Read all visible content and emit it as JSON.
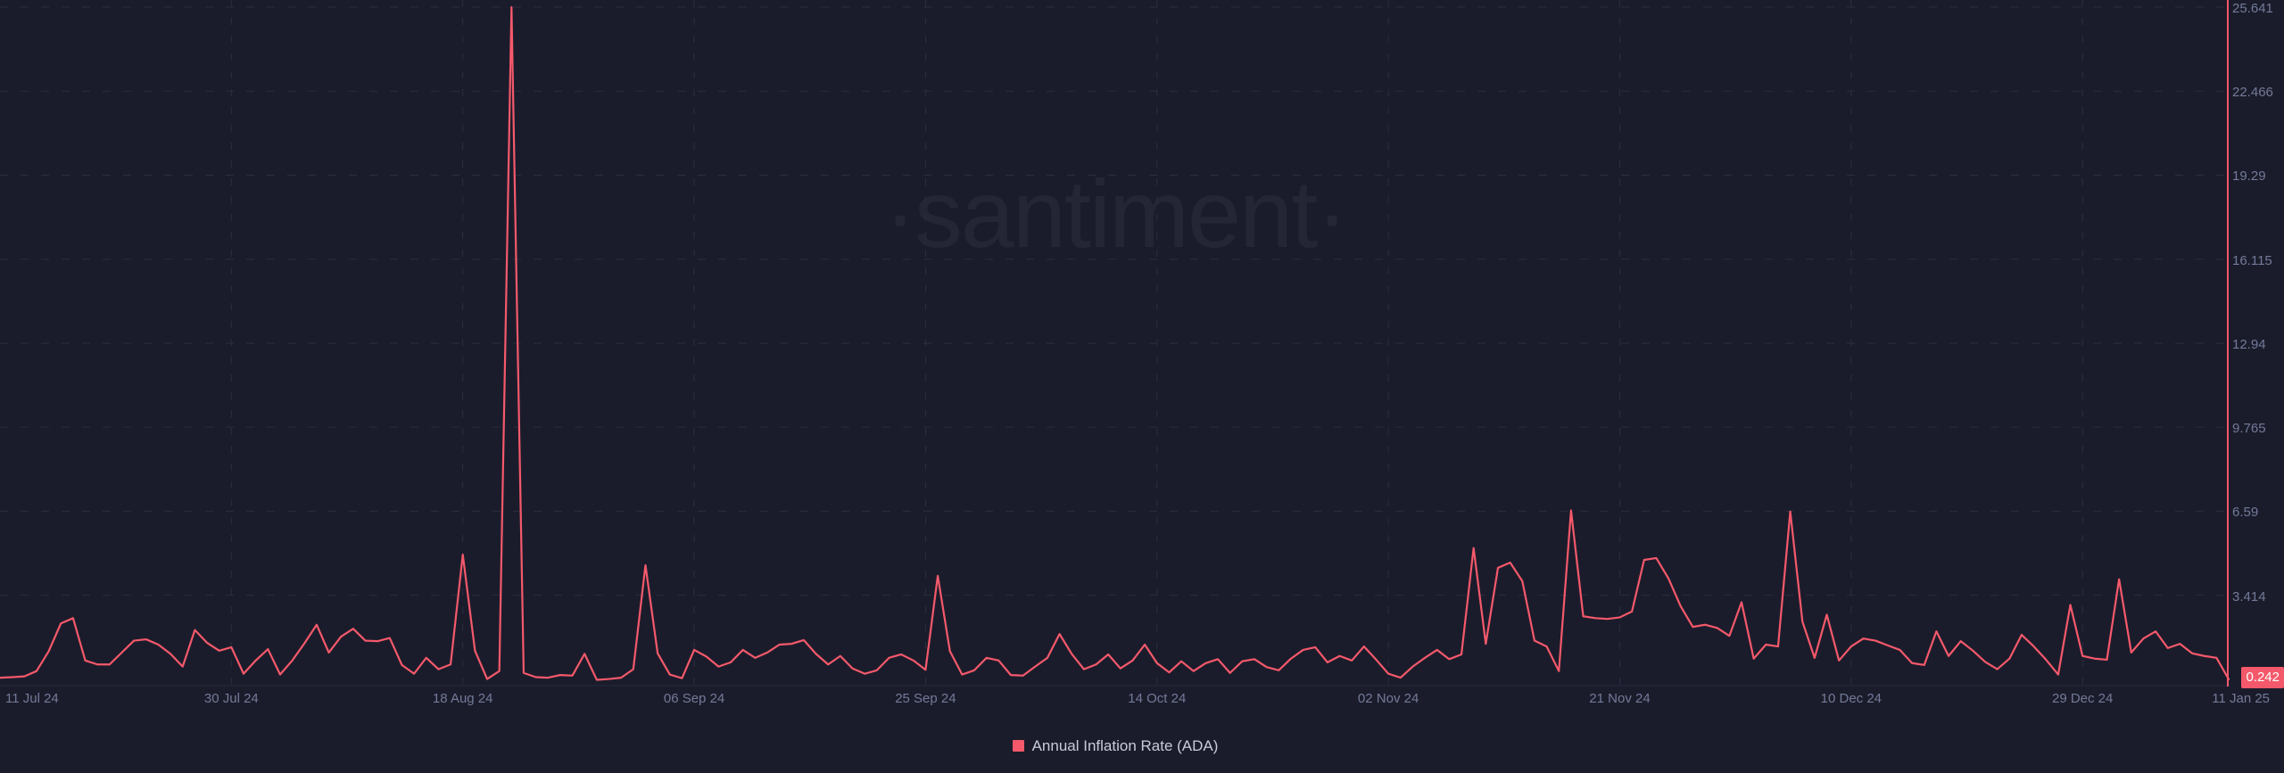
{
  "watermark": {
    "text": "·santiment·",
    "color": "#242636"
  },
  "theme": {
    "background": "#1b1c2b",
    "series_color": "#f4596b",
    "grid_color": "#2b2d40",
    "axis_text_color": "#737a99"
  },
  "legend": {
    "position": "bottom-center",
    "items": [
      {
        "label": "Annual Inflation Rate (ADA)",
        "color": "#f4596b",
        "marker": "square-swatch-icon"
      }
    ]
  },
  "last_value_badge": {
    "text": "0.242",
    "color": "#f4596b"
  },
  "cursor_line": {
    "x_fraction": 1.0,
    "color": "#f4596b"
  },
  "chart_data": {
    "type": "line",
    "title": "",
    "subtitle": "",
    "xlabel": "",
    "ylabel": "",
    "grid": true,
    "legend_position": "bottom-center",
    "ylim": [
      0,
      25.641
    ],
    "ytick_labels": [
      "25.641",
      "22.466",
      "19.29",
      "16.115",
      "12.94",
      "9.765",
      "6.59",
      "3.414"
    ],
    "yticks": [
      25.641,
      22.466,
      19.29,
      16.115,
      12.94,
      9.765,
      6.59,
      3.414
    ],
    "xtick_labels": [
      "11 Jul 24",
      "30 Jul 24",
      "18 Aug 24",
      "06 Sep 24",
      "25 Sep 24",
      "14 Oct 24",
      "02 Nov 24",
      "21 Nov 24",
      "10 Dec 24",
      "29 Dec 24",
      "11 Jan 25"
    ],
    "xtick_index": [
      0,
      19,
      38,
      57,
      76,
      95,
      114,
      133,
      152,
      171,
      184
    ],
    "x_start": "11 Jul 24",
    "x_end": "11 Jan 25",
    "series": [
      {
        "name": "Annual Inflation Rate (ADA)",
        "color": "#f4596b",
        "last_value": 0.242,
        "values": [
          0.3,
          0.32,
          0.35,
          0.55,
          1.3,
          2.35,
          2.55,
          0.95,
          0.8,
          0.8,
          1.25,
          1.7,
          1.75,
          1.55,
          1.2,
          0.72,
          2.1,
          1.62,
          1.32,
          1.45,
          0.45,
          0.95,
          1.38,
          0.42,
          0.95,
          1.6,
          2.3,
          1.25,
          1.85,
          2.15,
          1.7,
          1.68,
          1.8,
          0.78,
          0.45,
          1.05,
          0.62,
          0.8,
          4.95,
          1.32,
          0.25,
          0.55,
          25.64,
          0.48,
          0.32,
          0.3,
          0.4,
          0.38,
          1.2,
          0.22,
          0.25,
          0.3,
          0.62,
          4.55,
          1.22,
          0.42,
          0.28,
          1.35,
          1.1,
          0.72,
          0.88,
          1.35,
          1.05,
          1.25,
          1.55,
          1.58,
          1.72,
          1.2,
          0.8,
          1.12,
          0.65,
          0.45,
          0.58,
          1.05,
          1.18,
          0.95,
          0.6,
          4.15,
          1.3,
          0.42,
          0.58,
          1.05,
          0.95,
          0.4,
          0.38,
          0.72,
          1.05,
          1.95,
          1.2,
          0.62,
          0.8,
          1.18,
          0.65,
          0.95,
          1.55,
          0.85,
          0.5,
          0.92,
          0.55,
          0.85,
          1.0,
          0.48,
          0.92,
          1.0,
          0.7,
          0.58,
          1.02,
          1.35,
          1.45,
          0.88,
          1.12,
          0.95,
          1.48,
          0.98,
          0.45,
          0.3,
          0.72,
          1.05,
          1.35,
          1.0,
          1.18,
          5.2,
          1.58,
          4.45,
          4.65,
          3.95,
          1.7,
          1.48,
          0.55,
          6.62,
          2.62,
          2.55,
          2.52,
          2.58,
          2.8,
          4.75,
          4.82,
          4.05,
          3.0,
          2.22,
          2.3,
          2.18,
          1.88,
          3.15,
          1.02,
          1.55,
          1.48,
          6.58,
          2.42,
          1.05,
          2.68,
          0.95,
          1.48,
          1.78,
          1.7,
          1.52,
          1.35,
          0.85,
          0.78,
          2.05,
          1.12,
          1.68,
          1.32,
          0.9,
          0.62,
          1.02,
          1.92,
          1.48,
          0.98,
          0.42,
          3.05,
          1.12,
          1.02,
          0.98,
          4.02,
          1.25,
          1.78,
          2.05,
          1.42,
          1.58,
          1.22,
          1.12,
          1.05,
          0.242
        ]
      }
    ]
  }
}
